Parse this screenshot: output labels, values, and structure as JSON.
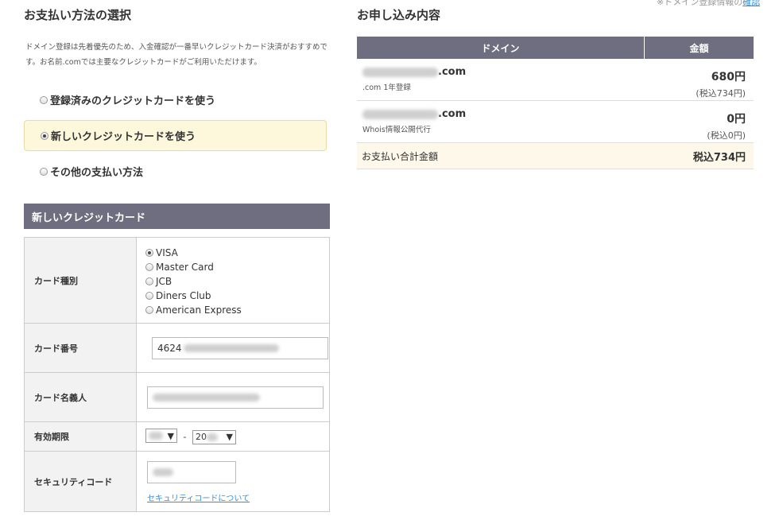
{
  "top_note": {
    "prefix": "※ドメイン登録情報の",
    "link": "確認"
  },
  "payment": {
    "title": "お支払い方法の選択",
    "intro": "ドメイン登録は先着優先のため、入金確認が一番早いクレジットカード決済がおすすめです。お名前.comでは主要なクレジットカードがご利用いただけます。",
    "options": [
      {
        "label": "登録済みのクレジットカードを使う",
        "selected": false
      },
      {
        "label": "新しいクレジットカードを使う",
        "selected": true
      },
      {
        "label": "その他の支払い方法",
        "selected": false
      }
    ]
  },
  "card_form": {
    "title": "新しいクレジットカード",
    "type_label": "カード種別",
    "types": [
      {
        "label": "VISA",
        "selected": true
      },
      {
        "label": "Master Card",
        "selected": false
      },
      {
        "label": "JCB",
        "selected": false
      },
      {
        "label": "Diners Club",
        "selected": false
      },
      {
        "label": "American Express",
        "selected": false
      }
    ],
    "number_label": "カード番号",
    "number_value": "4624",
    "holder_label": "カード名義人",
    "expiry_label": "有効期限",
    "expiry_year_prefix": "20",
    "expiry_sep": "-",
    "security_label": "セキュリティコード",
    "security_link": "セキュリティコードについて"
  },
  "order": {
    "title": "お申し込み内容",
    "col_domain": "ドメイン",
    "col_price": "金額",
    "rows": [
      {
        "domain_suffix": ".com",
        "sub": ".com 1年登録",
        "price": "680円",
        "tax": "(税込734円)"
      },
      {
        "domain_suffix": ".com",
        "sub": "Whois情報公開代行",
        "price": "0円",
        "tax": "(税込0円)"
      }
    ],
    "total_label": "お支払い合計金額",
    "total_value": "税込734円"
  }
}
